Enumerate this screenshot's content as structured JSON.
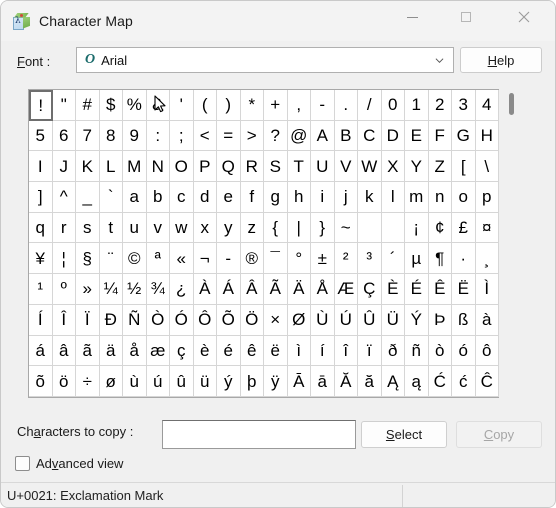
{
  "window": {
    "title": "Character Map",
    "app_icon": "character-map-icon",
    "controls": {
      "minimize": "minimize-icon",
      "maximize": "maximize-icon",
      "close": "close-icon"
    }
  },
  "font_row": {
    "label": "Font :",
    "label_prefix": "F",
    "label_rest": "ont :",
    "selected_font": "Arial",
    "font_type_icon": "truetype-icon",
    "dropdown_icon": "chevron-down-icon",
    "help_prefix": "H",
    "help_rest": "elp",
    "help_label": "Help"
  },
  "grid": {
    "selected_index": 0,
    "cursor_cell_index": 5,
    "cursor_icon": "mouse-pointer-icon",
    "characters": [
      "!",
      "\"",
      "#",
      "$",
      "%",
      "&",
      "'",
      "(",
      ")",
      "*",
      "+",
      ",",
      "-",
      ".",
      "/",
      "0",
      "1",
      "2",
      "3",
      "4",
      "5",
      "6",
      "7",
      "8",
      "9",
      ":",
      ";",
      "<",
      "=",
      ">",
      "?",
      "@",
      "A",
      "B",
      "C",
      "D",
      "E",
      "F",
      "G",
      "H",
      "I",
      "J",
      "K",
      "L",
      "M",
      "N",
      "O",
      "P",
      "Q",
      "R",
      "S",
      "T",
      "U",
      "V",
      "W",
      "X",
      "Y",
      "Z",
      "[",
      "\\",
      "]",
      "^",
      "_",
      "`",
      "a",
      "b",
      "c",
      "d",
      "e",
      "f",
      "g",
      "h",
      "i",
      "j",
      "k",
      "l",
      "m",
      "n",
      "o",
      "p",
      "q",
      "r",
      "s",
      "t",
      "u",
      "v",
      "w",
      "x",
      "y",
      "z",
      "{",
      "|",
      "}",
      "~",
      "",
      "",
      "¡",
      "¢",
      "£",
      "¤",
      "¥",
      "¦",
      "§",
      "¨",
      "©",
      "ª",
      "«",
      "¬",
      "-",
      "®",
      "¯",
      "°",
      "±",
      "²",
      "³",
      "´",
      "µ",
      "¶",
      "·",
      "¸",
      "¹",
      "º",
      "»",
      "¼",
      "½",
      "¾",
      "¿",
      "À",
      "Á",
      "Â",
      "Ã",
      "Ä",
      "Å",
      "Æ",
      "Ç",
      "È",
      "É",
      "Ê",
      "Ë",
      "Ì",
      "Í",
      "Î",
      "Ï",
      "Ð",
      "Ñ",
      "Ò",
      "Ó",
      "Ô",
      "Õ",
      "Ö",
      "×",
      "Ø",
      "Ù",
      "Ú",
      "Û",
      "Ü",
      "Ý",
      "Þ",
      "ß",
      "à",
      "á",
      "â",
      "ã",
      "ä",
      "å",
      "æ",
      "ç",
      "è",
      "é",
      "ê",
      "ë",
      "ì",
      "í",
      "î",
      "ï",
      "ð",
      "ñ",
      "ò",
      "ó",
      "ô",
      "õ",
      "ö",
      "÷",
      "ø",
      "ù",
      "ú",
      "û",
      "ü",
      "ý",
      "þ",
      "ÿ",
      "Ā",
      "ā",
      "Ă",
      "ă",
      "Ą",
      "ą",
      "Ć",
      "ć",
      "Ĉ"
    ],
    "scrollbar": "vertical-scrollbar"
  },
  "bottom": {
    "copy_label": "Characters to copy :",
    "copy_label_prefix": "Ch",
    "copy_label_mid": "a",
    "copy_label_rest": "racters to copy :",
    "copy_input_value": "",
    "copy_input_placeholder": "",
    "select_prefix": "S",
    "select_rest": "elect",
    "select_label": "Select",
    "copy_prefix": "C",
    "copy_rest": "opy",
    "copy_button_label": "Copy",
    "advanced_view_label": "Advanced view",
    "advanced_prefix": "Ad",
    "advanced_mid": "v",
    "advanced_rest": "anced view",
    "advanced_checked": false
  },
  "statusbar": {
    "text": "U+0021: Exclamation Mark"
  },
  "colors": {
    "window_bg": "#f0f0f0",
    "titlebar_bg": "#f3f3f3",
    "grid_bg": "#ffffff",
    "grid_line": "#d6d6d6",
    "selection_border": "#6e6e6e",
    "text": "#1a1a1a",
    "disabled_text": "#a6a6a6",
    "tt_icon": "#1b6b6b"
  }
}
